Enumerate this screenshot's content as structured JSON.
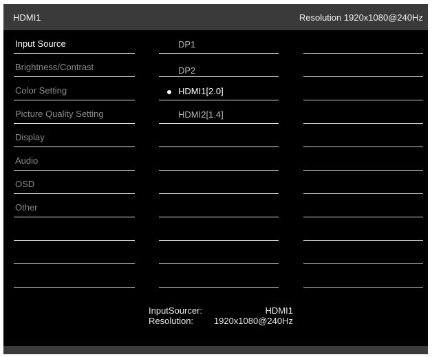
{
  "header": {
    "input_label": "HDMI1",
    "resolution_label": "Resolution 1920x1080@240Hz"
  },
  "menu": {
    "items": [
      {
        "label": "Input Source",
        "active": true
      },
      {
        "label": "Brightness/Contrast",
        "active": false
      },
      {
        "label": "Color Setting",
        "active": false
      },
      {
        "label": "Picture Quality Setting",
        "active": false
      },
      {
        "label": "Display",
        "active": false
      },
      {
        "label": "Audio",
        "active": false
      },
      {
        "label": "OSD",
        "active": false
      },
      {
        "label": "Other",
        "active": false
      }
    ]
  },
  "submenu": {
    "options": [
      {
        "label": "DP1",
        "selected": false
      },
      {
        "label": "DP2",
        "selected": false
      },
      {
        "label": "HDMI1[2.0]",
        "selected": true
      },
      {
        "label": "HDMI2[1.4]",
        "selected": false
      }
    ]
  },
  "info": {
    "input_key": "InputSourcer:",
    "input_value": "HDMI1",
    "resolution_key": "Resolution:",
    "resolution_value": "1920x1080@240Hz"
  },
  "colors": {
    "background": "#000000",
    "bar": "#3a3a3a",
    "active_text": "#ffffff",
    "inactive_text": "#8a8a8a"
  }
}
